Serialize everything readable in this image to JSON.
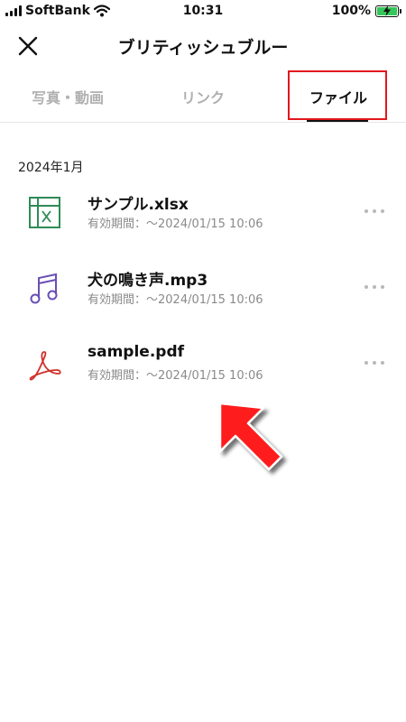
{
  "status_bar": {
    "carrier": "SoftBank",
    "time": "10:31",
    "battery": "100%"
  },
  "header": {
    "title": "ブリティッシュブルー"
  },
  "tabs": [
    {
      "label": "写真・動画"
    },
    {
      "label": "リンク"
    },
    {
      "label": "ファイル"
    }
  ],
  "month": "2024年1月",
  "files": [
    {
      "name": "サンプル.xlsx",
      "expiry": "有効期間：〜2024/01/15 10:06",
      "icon": "excel-file-icon",
      "color": "#2e8b57"
    },
    {
      "name": "犬の鳴き声.mp3",
      "expiry": "有効期間：〜2024/01/15 10:06",
      "icon": "music-note-icon",
      "color": "#6a4fb6"
    },
    {
      "name": "sample.pdf",
      "expiry": "有効期間：〜2024/01/15 10:06",
      "icon": "pdf-file-icon",
      "color": "#d0302a"
    }
  ],
  "colors": {
    "highlight": "#e3171c",
    "arrow": "#ff1a1a"
  }
}
